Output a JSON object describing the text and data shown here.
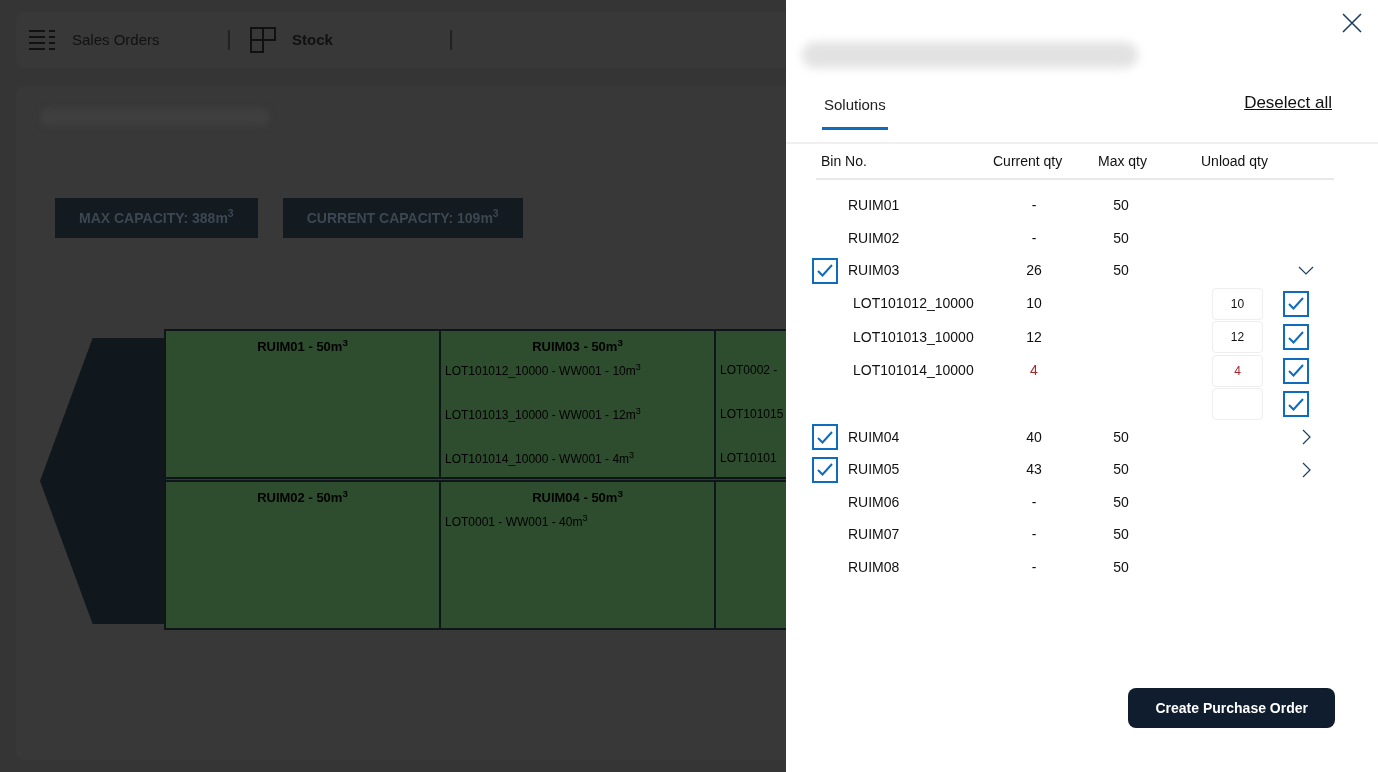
{
  "nav": [
    {
      "label": "Sales Orders",
      "kind": "list",
      "selected": false
    },
    {
      "label": "Stock",
      "kind": "grid",
      "selected": true
    }
  ],
  "capacity": [
    "MAX CAPACITY: 388m$^{3}$",
    "CURRENT CAPACITY: 109m$^{3}$"
  ],
  "bins": [
    {
      "title": "RUIM01 - 50m$^{3}$"
    },
    {
      "title": "RUIM02 - 50m$^{3}$"
    },
    {
      "title": "RUIM03 - 50m$^{3}$",
      "lots": [
        "LOT101012_10000 - WW001 - 10m$^{3}$",
        "LOT101013_10000 - WW001 - 12m$^{3}$",
        "LOT101014_10000 - WW001 - 4m$^{3}$"
      ]
    },
    {
      "title": "RUIM04 - 50m$^{3}$",
      "lots": [
        "LOT0001 - WW001 - 40m$^{3}$"
      ]
    },
    {
      "lots": [
        "LOT0002 -",
        "LOT101015",
        "LOT10101"
      ]
    }
  ],
  "panel": {
    "tabs": [
      {
        "label": "Solutions",
        "selected": true
      }
    ],
    "deselect_all": "Deselect all",
    "columns": [
      "Bin No.",
      "Current qty",
      "Max qty",
      "Unload qty"
    ],
    "rows": [
      {
        "bin": "RUIM01",
        "current": "-",
        "max": "50"
      },
      {
        "bin": "RUIM02",
        "current": "-",
        "max": "50"
      },
      {
        "bin": "RUIM03",
        "current": "26",
        "max": "50",
        "checked": true,
        "expanded": true,
        "lots": [
          {
            "lot": "LOT101012_10000",
            "qty": "10",
            "unload": "10",
            "checked": true,
            "flagged": false
          },
          {
            "lot": "LOT101013_10000",
            "qty": "12",
            "unload": "12",
            "checked": true,
            "flagged": false
          },
          {
            "lot": "LOT101014_10000",
            "qty": "4",
            "unload": "4",
            "checked": true,
            "flagged": true
          },
          {
            "checked": true
          }
        ]
      },
      {
        "bin": "RUIM04",
        "current": "40",
        "max": "50",
        "checked": true,
        "expanded": false
      },
      {
        "bin": "RUIM05",
        "current": "43",
        "max": "50",
        "checked": true,
        "expanded": false
      },
      {
        "bin": "RUIM06",
        "current": "-",
        "max": "50"
      },
      {
        "bin": "RUIM07",
        "current": "-",
        "max": "50"
      },
      {
        "bin": "RUIM08",
        "current": "-",
        "max": "50"
      }
    ],
    "button": "Create Purchase Order"
  }
}
